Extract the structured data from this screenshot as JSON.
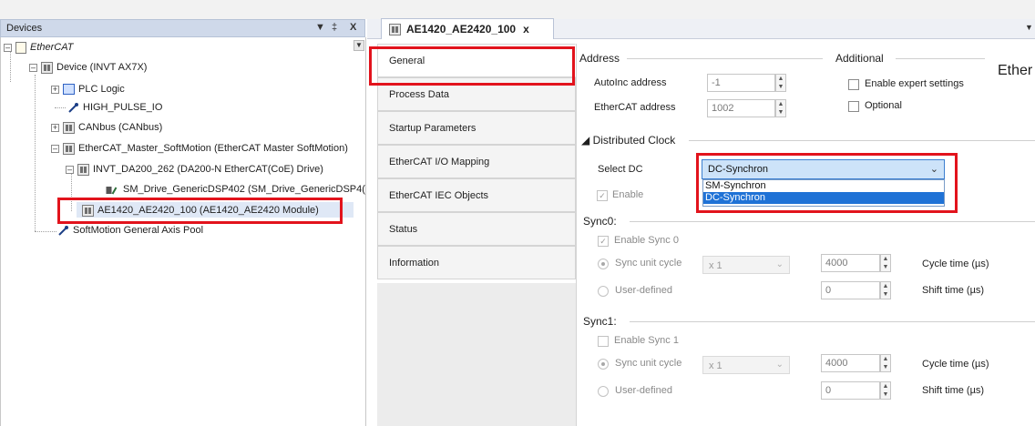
{
  "devices_panel": {
    "title": "Devices",
    "pin": "↓",
    "pin2": "‡",
    "close": "X",
    "tree": [
      {
        "label": "EtherCAT"
      },
      {
        "label": "Device (INVT AX7X)"
      },
      {
        "label": "PLC Logic"
      },
      {
        "label": "HIGH_PULSE_IO"
      },
      {
        "label": "CANbus (CANbus)"
      },
      {
        "label": "EtherCAT_Master_SoftMotion (EtherCAT Master SoftMotion)"
      },
      {
        "label": "INVT_DA200_262 (DA200-N EtherCAT(CoE) Drive)"
      },
      {
        "label": "SM_Drive_GenericDSP402 (SM_Drive_GenericDSP4("
      },
      {
        "label": "AE1420_AE2420_100 (AE1420_AE2420 Module)"
      },
      {
        "label": "SoftMotion General Axis Pool"
      }
    ]
  },
  "editor_tab": {
    "label": "AE1420_AE2420_100",
    "close": "x"
  },
  "vtabs": [
    {
      "label": "General"
    },
    {
      "label": "Process Data"
    },
    {
      "label": "Startup Parameters"
    },
    {
      "label": "EtherCAT I/O Mapping"
    },
    {
      "label": "EtherCAT IEC Objects"
    },
    {
      "label": "Status"
    },
    {
      "label": "Information"
    }
  ],
  "general": {
    "address_title": "Address",
    "additional_title": "Additional",
    "autoinc_label": "AutoInc address",
    "autoinc_value": "-1",
    "ethercat_address_label": "EtherCAT address",
    "ethercat_address_value": "1002",
    "enable_expert_label": "Enable expert settings",
    "optional_label": "Optional",
    "ether_partial": "Ether",
    "dc_title": "Distributed Clock",
    "select_dc_label": "Select DC",
    "select_dc_value": "DC-Synchron",
    "dc_options": [
      "SM-Synchron",
      "DC-Synchron"
    ],
    "dc_selected_index": 1,
    "enable_label": "Enable",
    "sync0_title": "Sync0:",
    "enable_sync0_label": "Enable Sync 0",
    "sync_unit_cycle_label": "Sync unit cycle",
    "sync_unit_cycle_value": "x 1",
    "user_defined_label": "User-defined",
    "sync0_cycle_value": "4000",
    "sync0_shift_value": "0",
    "cycle_time_label": "Cycle time (µs)",
    "shift_time_label": "Shift time (µs)",
    "sync1_title": "Sync1:",
    "enable_sync1_label": "Enable Sync 1",
    "sync1_cycle_value": "4000",
    "sync1_shift_value": "0"
  },
  "colors": {
    "highlight_red": "#e2131c",
    "panel_header": "#cfd9ea",
    "select_bg": "#cde3f9",
    "list_selected": "#1f72d6"
  }
}
